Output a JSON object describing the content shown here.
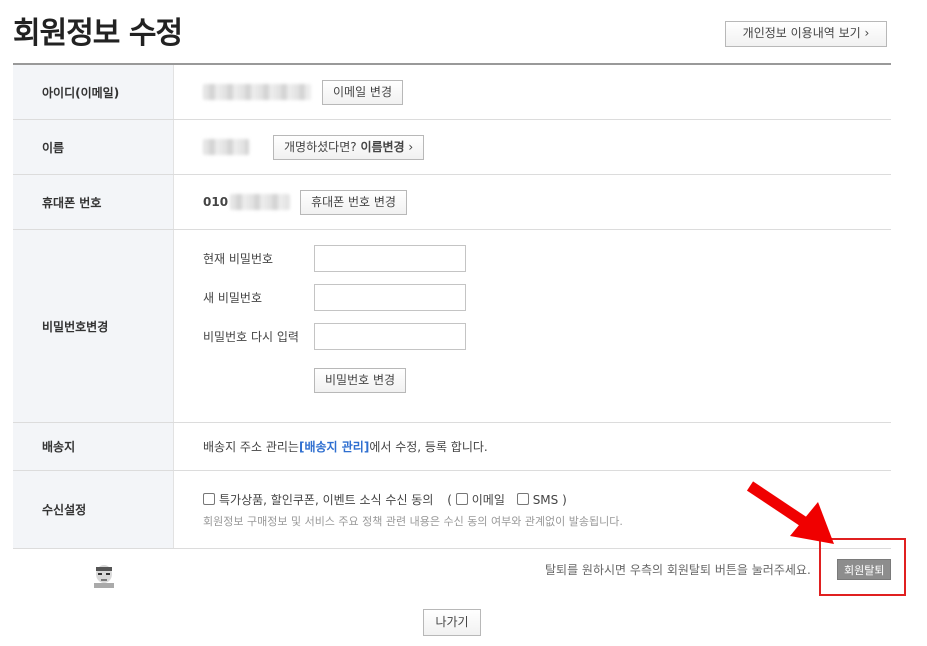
{
  "page": {
    "title": "회원정보 수정",
    "history_button": "개인정보 이용내역 보기 ›"
  },
  "rows": {
    "id": {
      "label": "아이디(이메일)",
      "button": "이메일 변경"
    },
    "name": {
      "label": "이름",
      "button_prefix": "개명하셨다면? ",
      "button_bold": "이름변경",
      "button_suffix": " ›"
    },
    "phone": {
      "label": "휴대폰 번호",
      "prefix": "010",
      "button": "휴대폰 번호 변경"
    },
    "password": {
      "label": "비밀번호변경",
      "current_label": "현재 비밀번호",
      "new_label": "새 비밀번호",
      "confirm_label": "비밀번호 다시 입력",
      "button": "비밀번호 변경"
    },
    "shipping": {
      "label": "배송지",
      "text_before": "배송지 주소 관리는 ",
      "link": "[배송지 관리]",
      "text_after": "에서 수정, 등록 합니다."
    },
    "consent": {
      "label": "수신설정",
      "main_option": "특가상품, 할인쿠폰, 이벤트 소식 수신 동의",
      "paren_open": "(",
      "email_option": "이메일",
      "sms_option": "SMS",
      "paren_close": ")",
      "note": "회원정보 구매정보 및 서비스 주요 정책 관련 내용은 수신 동의 여부와 관계없이 발송됩니다."
    }
  },
  "footer": {
    "withdraw_note": "탈퇴를 원하시면 우측의 회원탈퇴 버튼을 눌러주세요.",
    "withdraw_button": "회원탈퇴",
    "exit_button": "나가기"
  },
  "colors": {
    "highlight": "#e02020",
    "label_bg": "#f3f5f8",
    "link": "#2f6fd0"
  }
}
